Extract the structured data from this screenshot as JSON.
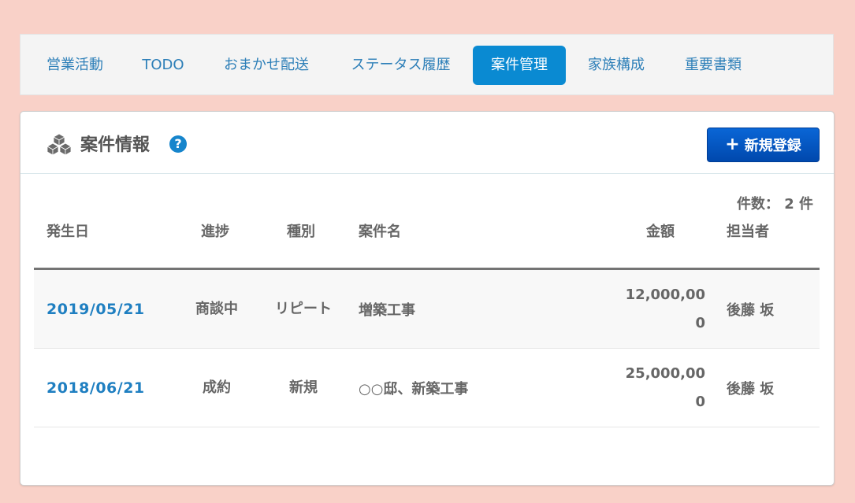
{
  "tabs": [
    {
      "label": "営業活動",
      "active": false
    },
    {
      "label": "TODO",
      "active": false
    },
    {
      "label": "おまかせ配送",
      "active": false
    },
    {
      "label": "ステータス履歴",
      "active": false
    },
    {
      "label": "案件管理",
      "active": true
    },
    {
      "label": "家族構成",
      "active": false
    },
    {
      "label": "重要書類",
      "active": false
    }
  ],
  "panel": {
    "title": "案件情報",
    "help_icon": "question-circle-icon",
    "help_glyph": "?",
    "new_button_label": "新規登録",
    "plus_glyph": "+",
    "count_text": "件数： 2 件"
  },
  "table": {
    "headers": {
      "date": "発生日",
      "progress": "進捗",
      "type": "種別",
      "name": "案件名",
      "amount": "金額",
      "owner": "担当者"
    },
    "rows": [
      {
        "date": "2019/05/21",
        "progress": "商談中",
        "type": "リピート",
        "name": "増築工事",
        "amount": "12,000,000",
        "owner": "後藤 坂"
      },
      {
        "date": "2018/06/21",
        "progress": "成約",
        "type": "新規",
        "name": "○○邸、新築工事",
        "amount": "25,000,000",
        "owner": "後藤 坂"
      }
    ]
  },
  "colors": {
    "background": "#f9d1c8",
    "accent": "#0a8ad2",
    "button": "#0055c4",
    "link": "#1f7fc1"
  }
}
